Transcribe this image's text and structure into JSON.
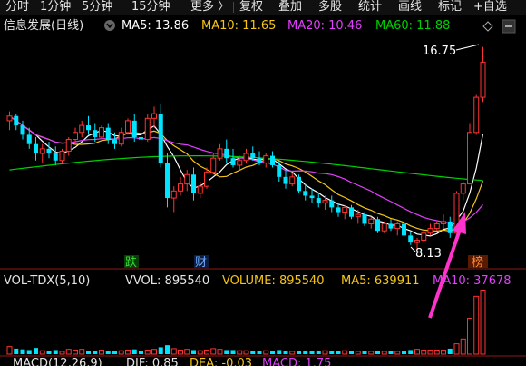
{
  "toolbar": {
    "items": [
      "分时",
      "1分钟",
      "5分钟",
      "15分钟",
      "更多",
      "复权",
      "叠加",
      "多股",
      "统计",
      "画线",
      "标记",
      "+自选"
    ]
  },
  "main": {
    "stock_title": "信息发展(日线)",
    "ma": {
      "ma5": "MA5: 13.86",
      "ma10": "MA10: 11.65",
      "ma20": "MA20: 10.46",
      "ma60": "MA60: 11.88"
    },
    "price_high_label": "16.75",
    "price_low_label": "8.13",
    "marker_die": "跌",
    "marker_cai": "财",
    "marker_bang": "榜"
  },
  "volume": {
    "title": "VOL-TDX(5,10)",
    "vvol": "VVOL: 895540",
    "volume": "VOLUME: 895540",
    "ma5": "MA5: 639911",
    "ma10": "MA10: 37678"
  },
  "macd": {
    "title": "MACD(12,26,9)",
    "dif": "DIF: 0.85",
    "dea": "DEA: -0.03",
    "macd": "MACD: 1.75"
  },
  "colors": {
    "up": "#ff3333",
    "down": "#00e5ff",
    "ma5": "#ffffff",
    "ma10": "#f5c518",
    "ma20": "#e040fb",
    "ma60": "#00d000",
    "arrow": "#ff33cc"
  },
  "candles": [
    [
      13.6,
      14.0,
      13.2,
      13.8
    ],
    [
      13.8,
      13.9,
      13.2,
      13.4
    ],
    [
      13.4,
      13.6,
      12.8,
      13.0
    ],
    [
      13.0,
      13.3,
      12.4,
      12.6
    ],
    [
      12.6,
      12.9,
      11.9,
      12.2
    ],
    [
      12.2,
      12.6,
      11.8,
      12.4
    ],
    [
      12.4,
      12.7,
      12.0,
      12.2
    ],
    [
      12.2,
      12.5,
      11.7,
      11.9
    ],
    [
      11.9,
      12.4,
      11.8,
      12.3
    ],
    [
      12.3,
      12.9,
      12.1,
      12.8
    ],
    [
      12.8,
      13.3,
      12.6,
      13.1
    ],
    [
      13.1,
      13.6,
      12.9,
      13.4
    ],
    [
      13.4,
      13.8,
      13.0,
      13.2
    ],
    [
      13.2,
      13.5,
      12.7,
      12.9
    ],
    [
      12.9,
      13.4,
      12.8,
      13.3
    ],
    [
      13.3,
      13.5,
      12.6,
      12.8
    ],
    [
      12.8,
      13.1,
      12.4,
      12.6
    ],
    [
      12.6,
      13.3,
      12.5,
      13.1
    ],
    [
      13.1,
      13.7,
      13.0,
      13.6
    ],
    [
      13.6,
      13.9,
      12.7,
      12.9
    ],
    [
      12.9,
      13.2,
      12.5,
      12.8
    ],
    [
      12.8,
      13.9,
      12.7,
      13.7
    ],
    [
      13.7,
      14.2,
      13.3,
      13.9
    ],
    [
      13.9,
      14.3,
      11.6,
      11.8
    ],
    [
      11.8,
      12.2,
      9.9,
      10.3
    ],
    [
      10.3,
      10.8,
      9.7,
      10.6
    ],
    [
      10.6,
      11.2,
      10.4,
      10.9
    ],
    [
      10.9,
      11.5,
      10.6,
      11.3
    ],
    [
      11.3,
      11.6,
      10.2,
      10.5
    ],
    [
      10.5,
      11.0,
      10.3,
      10.8
    ],
    [
      10.8,
      11.6,
      10.7,
      11.4
    ],
    [
      11.4,
      12.2,
      11.3,
      12.0
    ],
    [
      12.0,
      12.6,
      11.9,
      12.4
    ],
    [
      12.4,
      12.8,
      11.8,
      12.0
    ],
    [
      12.0,
      12.4,
      11.6,
      11.7
    ],
    [
      11.7,
      12.1,
      11.5,
      11.9
    ],
    [
      11.9,
      12.4,
      11.8,
      12.2
    ],
    [
      12.2,
      12.5,
      11.9,
      12.0
    ],
    [
      12.0,
      12.3,
      11.7,
      11.8
    ],
    [
      11.8,
      12.2,
      11.6,
      12.1
    ],
    [
      12.1,
      12.3,
      11.6,
      11.7
    ],
    [
      11.7,
      11.9,
      11.0,
      11.2
    ],
    [
      11.2,
      11.5,
      10.7,
      10.9
    ],
    [
      10.9,
      11.4,
      10.8,
      11.2
    ],
    [
      11.2,
      11.3,
      10.5,
      10.6
    ],
    [
      10.6,
      10.9,
      10.2,
      10.4
    ],
    [
      10.4,
      10.7,
      10.1,
      10.3
    ],
    [
      10.3,
      10.5,
      9.9,
      10.1
    ],
    [
      10.1,
      10.4,
      9.8,
      10.2
    ],
    [
      10.2,
      10.4,
      9.7,
      9.9
    ],
    [
      9.9,
      10.1,
      9.5,
      9.7
    ],
    [
      9.7,
      10.0,
      9.4,
      9.9
    ],
    [
      9.9,
      10.0,
      9.4,
      9.5
    ],
    [
      9.5,
      9.8,
      9.2,
      9.6
    ],
    [
      9.6,
      9.7,
      9.1,
      9.2
    ],
    [
      9.2,
      9.5,
      9.0,
      9.4
    ],
    [
      9.4,
      9.5,
      8.8,
      8.9
    ],
    [
      8.9,
      9.3,
      8.8,
      9.2
    ],
    [
      9.2,
      9.4,
      8.9,
      9.0
    ],
    [
      9.0,
      9.3,
      8.7,
      9.2
    ],
    [
      9.2,
      9.4,
      8.6,
      8.7
    ],
    [
      8.7,
      8.9,
      8.3,
      8.4
    ],
    [
      8.4,
      8.6,
      8.13,
      8.5
    ],
    [
      8.5,
      8.9,
      8.4,
      8.8
    ],
    [
      8.8,
      9.2,
      8.7,
      9.0
    ],
    [
      9.0,
      9.3,
      8.9,
      9.2
    ],
    [
      9.2,
      9.6,
      9.0,
      9.3
    ],
    [
      9.3,
      9.5,
      8.6,
      8.8
    ],
    [
      8.8,
      10.6,
      8.8,
      10.5
    ],
    [
      10.5,
      11.0,
      10.2,
      10.9
    ],
    [
      10.9,
      13.5,
      10.9,
      13.1
    ],
    [
      13.1,
      14.7,
      13.0,
      14.6
    ],
    [
      14.6,
      16.75,
      14.4,
      16.1
    ]
  ],
  "volumes": [
    1.1,
    0.8,
    0.7,
    0.6,
    0.9,
    0.5,
    0.5,
    0.6,
    0.4,
    0.7,
    0.6,
    0.7,
    0.5,
    0.5,
    0.6,
    0.5,
    0.4,
    0.5,
    0.6,
    0.7,
    0.5,
    0.6,
    0.7,
    1.0,
    1.3,
    0.8,
    0.6,
    0.7,
    0.6,
    0.5,
    0.6,
    0.8,
    0.7,
    0.6,
    0.6,
    0.5,
    0.5,
    0.5,
    0.4,
    0.5,
    0.5,
    0.6,
    0.5,
    0.4,
    0.5,
    0.5,
    0.4,
    0.4,
    0.5,
    0.4,
    0.4,
    0.5,
    0.4,
    0.4,
    0.5,
    0.4,
    0.5,
    0.4,
    0.4,
    0.4,
    0.5,
    0.6,
    0.7,
    0.6,
    0.6,
    0.6,
    0.6,
    0.8,
    1.5,
    2.2,
    5.2,
    8.4,
    9.3
  ]
}
